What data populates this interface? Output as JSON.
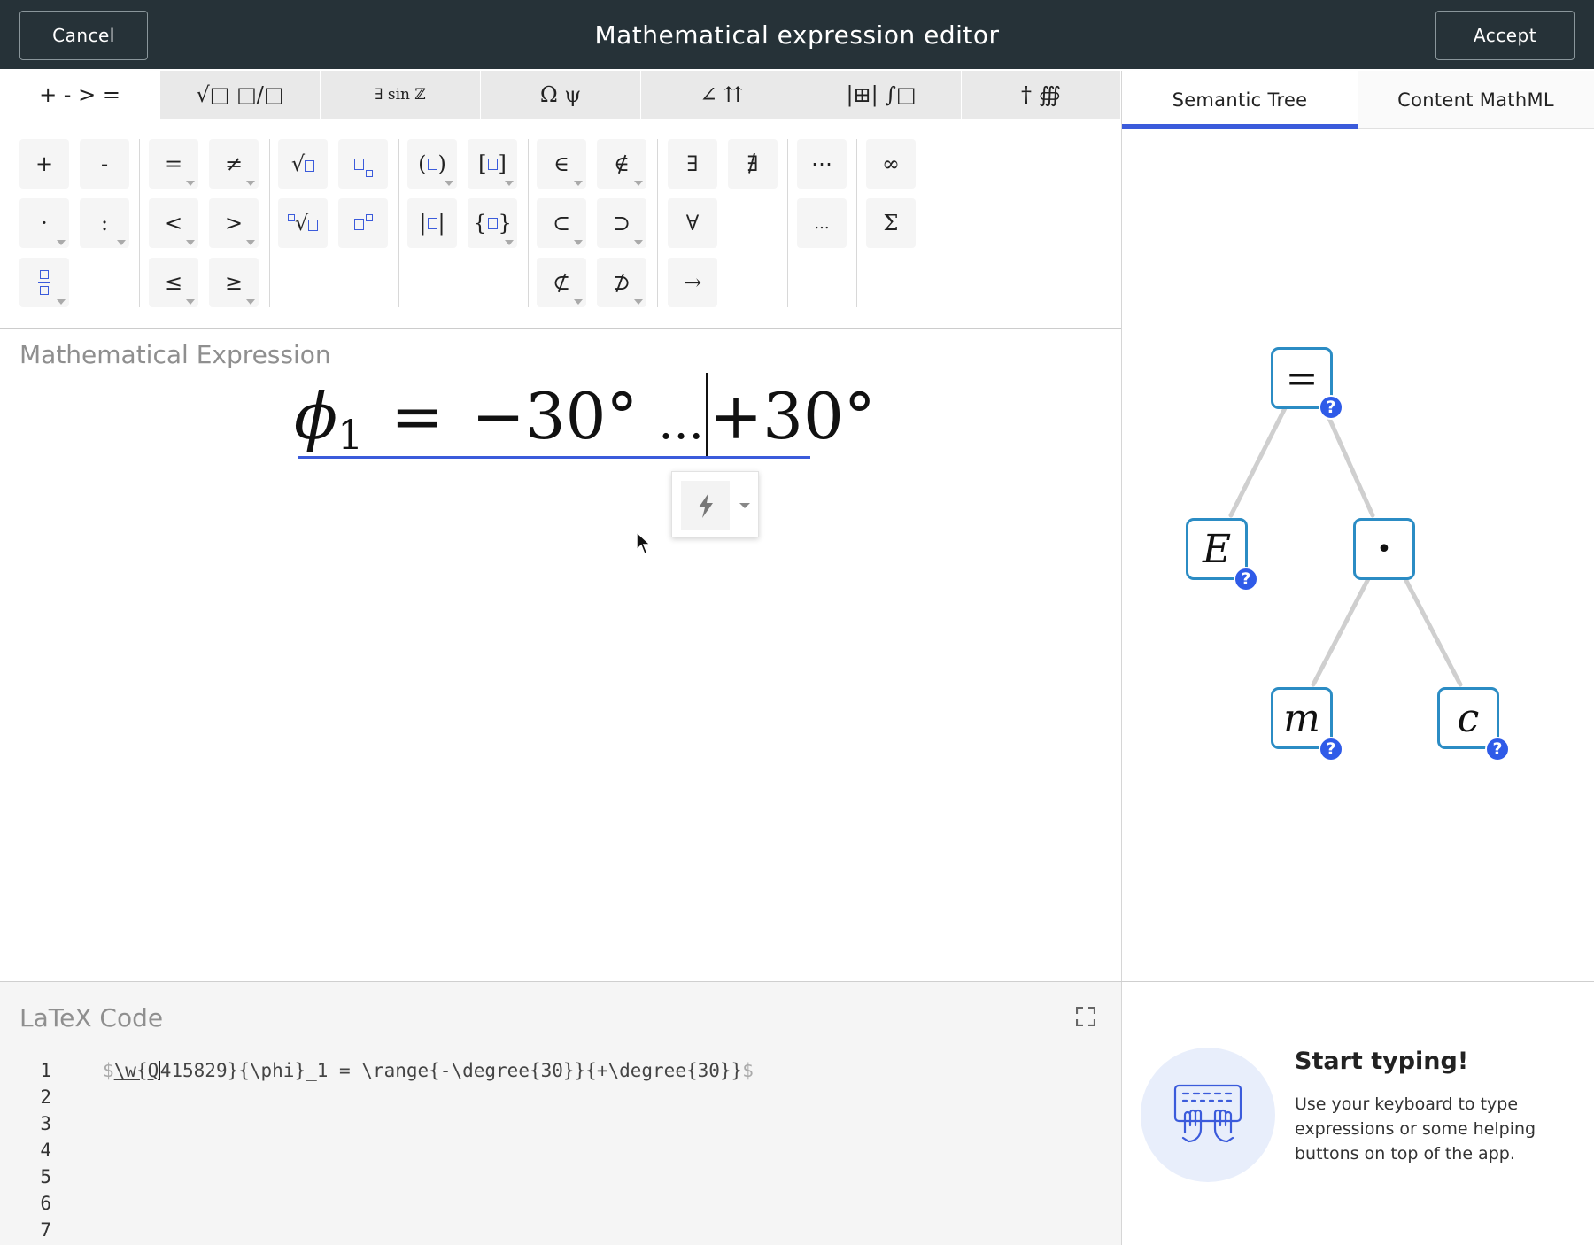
{
  "header": {
    "title": "Mathematical expression editor",
    "cancel_label": "Cancel",
    "accept_label": "Accept"
  },
  "category_tabs": [
    "+ - > =",
    "√□ □/□",
    "∃ sin ℤ",
    "Ω ψ",
    "∠ ⇈",
    "|⊞| ∫□",
    "† ∰"
  ],
  "palette": {
    "plus": "+",
    "minus": "-",
    "equals": "=",
    "not_equals": "≠",
    "cdot": "·",
    "colon": ":",
    "less": "<",
    "greater": ">",
    "leq": "≤",
    "geq": "≥",
    "paren": "(□)",
    "bracket": "[□]",
    "abs": "|□|",
    "brace": "{□}",
    "element_of": "∈",
    "not_element_of": "∉",
    "subset": "⊂",
    "superset": "⊃",
    "not_subset": "⊄",
    "not_superset": "⊅",
    "exists": "∃",
    "not_exists": "∄",
    "forall": "∀",
    "implies": "→",
    "cdots": "⋯",
    "ldots": "...",
    "infinity": "∞",
    "sum": "Σ"
  },
  "expression": {
    "label": "Mathematical Expression",
    "phi": "ϕ",
    "phi_sub": "1",
    "equals": "=",
    "left": "−30°",
    "range": "...",
    "right": "+30°"
  },
  "side_tabs": {
    "semantic_tree": "Semantic Tree",
    "content_mathml": "Content MathML"
  },
  "tree": {
    "root": "=",
    "left": "E",
    "right": "•",
    "right_left": "m",
    "right_right": "c",
    "help": "?"
  },
  "latex": {
    "label": "LaTeX Code",
    "line_numbers": [
      "1",
      "2",
      "3",
      "4",
      "5",
      "6",
      "7"
    ],
    "dollar_open": "$",
    "code_underlined": "\\w{Q",
    "code_rest": "415829}{\\phi}_1 = \\range{-\\degree{30}}{+\\degree{30}}",
    "dollar_close": "$"
  },
  "tip": {
    "title": "Start typing!",
    "body": "Use your keyboard to type expressions or some helping buttons on top of the app."
  },
  "colors": {
    "header_bg": "#263238",
    "accent": "#3b5bdb",
    "node_border": "#2b8cc4",
    "help_badge": "#2f5be8"
  }
}
